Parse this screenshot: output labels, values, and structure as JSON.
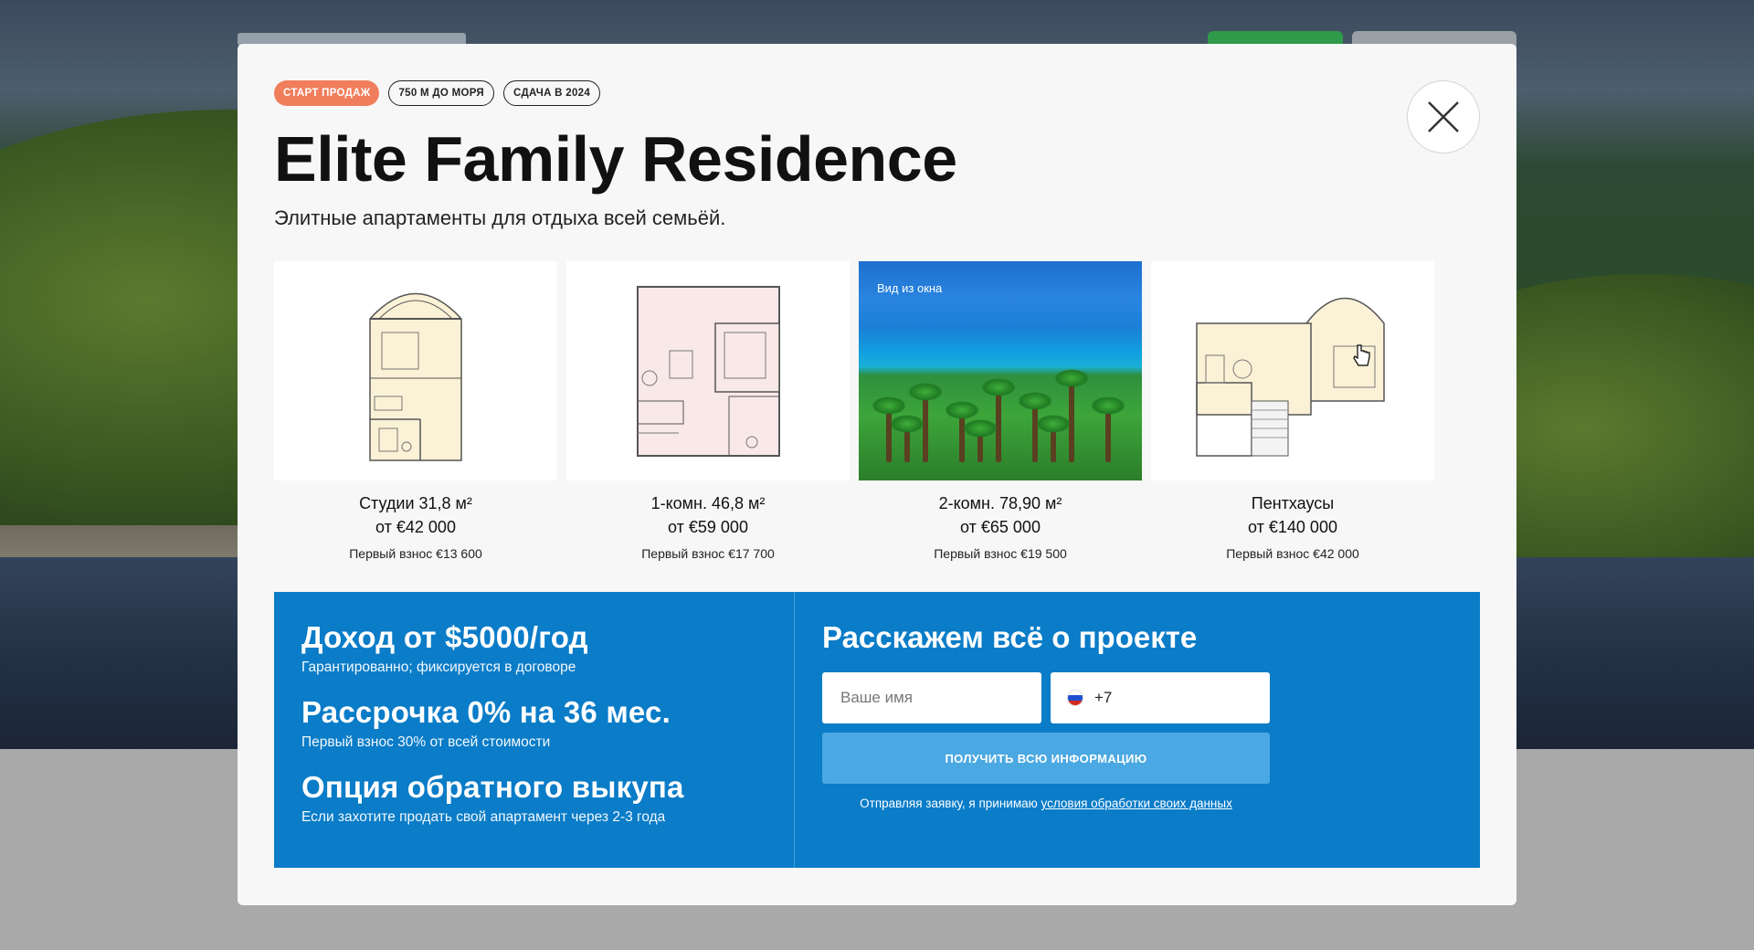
{
  "modal": {
    "badges": [
      "СТАРТ ПРОДАЖ",
      "750 М ДО МОРЯ",
      "СДАЧА В 2024"
    ],
    "title": "Elite Family Residence",
    "subtitle": "Элитные апартаменты для отдыха всей семьёй.",
    "close_icon": "close-icon"
  },
  "cards": [
    {
      "title": "Студии 31,8 м²",
      "price": "от €42 000",
      "down_payment": "Первый взнос €13 600",
      "image": "floorplan-studio"
    },
    {
      "title": "1-комн. 46,8 м²",
      "price": "от €59 000",
      "down_payment": "Первый взнос €17 700",
      "image": "floorplan-1room"
    },
    {
      "title": "2-комн. 78,90 м²",
      "price": "от €65 000",
      "down_payment": "Первый взнос €19 500",
      "image": "sea-view-photo",
      "image_label": "Вид из окна"
    },
    {
      "title": "Пентхаусы",
      "price": "от €140 000",
      "down_payment": "Первый взнос €42 000",
      "image": "floorplan-penthouse"
    }
  ],
  "promo": {
    "items": [
      {
        "heading": "Доход от $5000/год",
        "sub": "Гарантированно; фиксируется в договоре"
      },
      {
        "heading": "Рассрочка 0% на 36 мес.",
        "sub": "Первый взнос 30% от всей стоимости"
      },
      {
        "heading": "Опция обратного выкупа",
        "sub": "Если захотите продать свой апартамент через 2-3 года"
      }
    ],
    "form": {
      "title": "Расскажем всё о проекте",
      "name_placeholder": "Ваше имя",
      "phone_code": "+7",
      "submit_label": "ПОЛУЧИТЬ ВСЮ ИНФОРМАЦИЮ",
      "consent_text": "Отправляя заявку, я принимаю",
      "consent_link": "условия обработки своих данных"
    }
  },
  "colors": {
    "accent_badge": "#f07e5c",
    "promo_bg": "#0a7cc8",
    "submit_bg": "#4aa8e2"
  }
}
